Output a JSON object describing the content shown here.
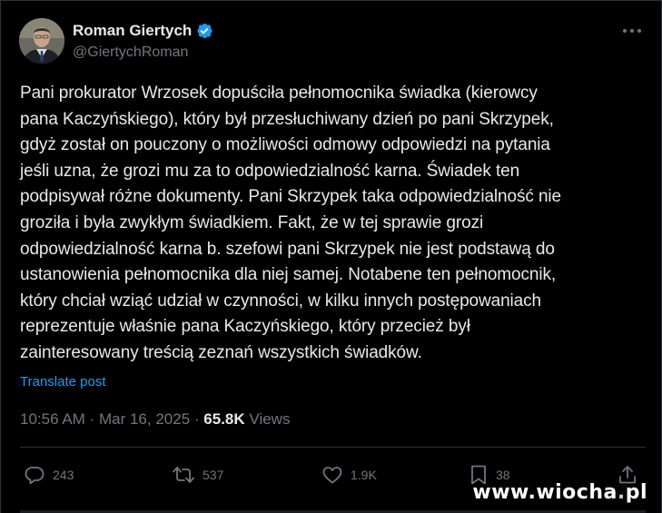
{
  "author": {
    "display_name": "Roman Giertych",
    "handle": "@GiertychRoman",
    "avatar_icon": "user-portrait",
    "verified_color": "#1d9bf0"
  },
  "post": {
    "text": "Pani prokurator Wrzosek dopuściła pełnomocnika świadka (kierowcy\npana Kaczyńskiego), który był przesłuchiwany dzień po pani Skrzypek,\ngdyż został on pouczony o możliwości odmowy odpowiedzi na pytania\njeśli uzna, że grozi mu za to odpowiedzialność karna. Świadek ten\npodpisywał różne dokumenty. Pani Skrzypek taka odpowiedzialność nie\ngroziła i była zwykłym świadkiem. Fakt, że w tej sprawie grozi\nodpowiedzialność karna b. szefowi pani Skrzypek nie jest podstawą do\nustanowienia pełnomocnika dla niej samej. Notabene ten pełnomocnik,\nktóry chciał wziąć udział w czynności, w kilku innych postępowaniach\nreprezentuje właśnie pana Kaczyńskiego, który przecież był\nzainteresowany treścią zeznań wszystkich świadków.",
    "translate_label": "Translate post"
  },
  "meta": {
    "time": "10:56 AM",
    "separator": "·",
    "date": "Mar 16, 2025",
    "views_count": "65.8K",
    "views_label": "Views"
  },
  "actions": {
    "replies": "243",
    "reposts": "537",
    "likes": "1.9K",
    "bookmarks": "38"
  },
  "watermark": {
    "text_left": "www.",
    "text_mid": "wiocha",
    "text_dot": ".",
    "text_right": "pl"
  },
  "colors": {
    "background": "#000000",
    "text": "#e7e9ea",
    "muted": "#71767b",
    "accent": "#1d9bf0"
  }
}
